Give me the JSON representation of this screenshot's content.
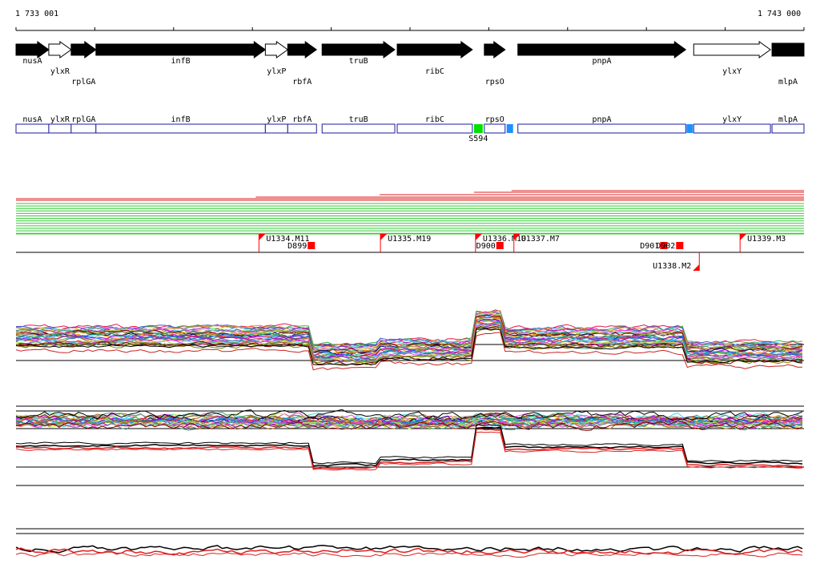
{
  "ruler": {
    "start_label": "1 733 001",
    "end_label": "1 743 000"
  },
  "colors": {
    "gene_fill": "#000000",
    "gene_outline_fill": "#ffffff",
    "segment_stroke": "#1a1aa0",
    "marker_red": "#ff0000",
    "marker_green": "#00e000",
    "marker_blue": "#1e90ff",
    "trace_green": "#33cc33",
    "trace_red": "#dd2222"
  },
  "genes": [
    {
      "label": "nusA",
      "filled": true,
      "start": 0,
      "end": 41,
      "label_row": 0
    },
    {
      "label": "ylxR",
      "filled": false,
      "start": 41,
      "end": 69,
      "label_row": 1
    },
    {
      "label": "rplGA",
      "filled": true,
      "start": 69,
      "end": 100,
      "label_row": 2
    },
    {
      "label": "infB",
      "filled": true,
      "start": 100,
      "end": 312,
      "label_row": 0
    },
    {
      "label": "ylxP",
      "filled": false,
      "start": 312,
      "end": 340,
      "label_row": 1
    },
    {
      "label": "rbfA",
      "filled": true,
      "start": 340,
      "end": 376,
      "label_row": 2
    },
    {
      "label": "truB",
      "filled": true,
      "start": 383,
      "end": 474,
      "label_row": 0
    },
    {
      "label": "ribC",
      "filled": true,
      "start": 477,
      "end": 571,
      "label_row": 1
    },
    {
      "label": "rpsO",
      "filled": true,
      "start": 586,
      "end": 612,
      "label_row": 2
    },
    {
      "label": "pnpA",
      "filled": true,
      "start": 628,
      "end": 838,
      "label_row": 0
    },
    {
      "label": "ylxY",
      "filled": false,
      "start": 848,
      "end": 944,
      "label_row": 1
    },
    {
      "label": "mlpA",
      "filled": true,
      "start": 946,
      "end": 986,
      "label_row": 2,
      "open_end": true
    }
  ],
  "segments": [
    {
      "label": "nusA",
      "start": 0,
      "end": 41
    },
    {
      "label": "ylxR",
      "start": 41,
      "end": 69
    },
    {
      "label": "rplGA",
      "start": 69,
      "end": 100
    },
    {
      "label": "infB",
      "start": 100,
      "end": 312
    },
    {
      "label": "ylxP",
      "start": 312,
      "end": 340
    },
    {
      "label": "rbfA",
      "start": 340,
      "end": 376
    },
    {
      "label": "truB",
      "start": 383,
      "end": 474
    },
    {
      "label": "ribC",
      "start": 477,
      "end": 571
    },
    {
      "label": "rpsO",
      "start": 586,
      "end": 612
    },
    {
      "label": "pnpA",
      "start": 628,
      "end": 838
    },
    {
      "label": "ylxY",
      "start": 848,
      "end": 944
    },
    {
      "label": "mlpA",
      "start": 946,
      "end": 986
    }
  ],
  "segment_markers": [
    {
      "label": "S594",
      "color": "green",
      "start": 573,
      "end": 584
    },
    {
      "label": "",
      "color": "blue",
      "start": 614,
      "end": 622
    },
    {
      "label": "",
      "color": "blue",
      "start": 839,
      "end": 847
    }
  ],
  "flags": [
    {
      "label": "U1334.M11",
      "pos": 304,
      "row": 0
    },
    {
      "label": "U1335.M19",
      "pos": 456,
      "row": 0
    },
    {
      "label": "U1336.M10",
      "pos": 575,
      "row": 0
    },
    {
      "label": "U1337.M7",
      "pos": 623,
      "row": 0
    },
    {
      "label": "U1339.M3",
      "pos": 906,
      "row": 0
    },
    {
      "label": "U1338.M2",
      "pos": 855,
      "row": 1
    }
  ],
  "boxes": [
    {
      "label": "D899",
      "pos": 365
    },
    {
      "label": "D900",
      "pos": 601
    },
    {
      "label": "D901",
      "pos": 806
    },
    {
      "label": "D902",
      "pos": 826
    }
  ]
}
